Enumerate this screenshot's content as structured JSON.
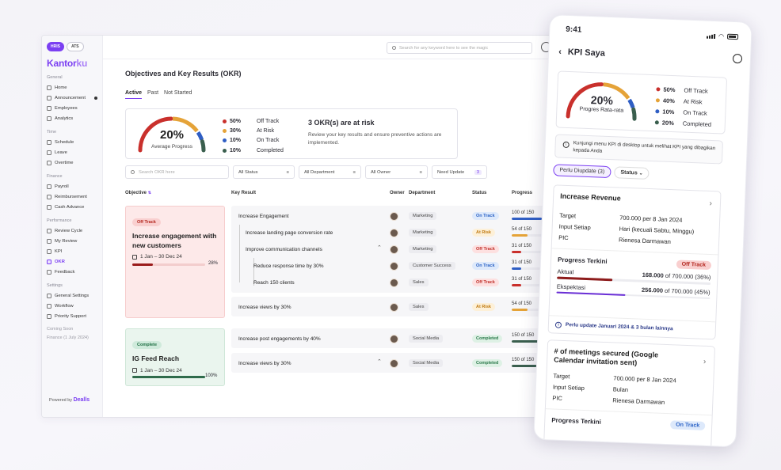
{
  "sidebar": {
    "pills": [
      "HRIS",
      "ATS"
    ],
    "logo": "Kantor",
    "logo_suffix": "ku",
    "sections": [
      {
        "title": "General",
        "items": [
          "Home",
          "Announcement",
          "Employees",
          "Analytics"
        ]
      },
      {
        "title": "Time",
        "items": [
          "Schedule",
          "Leave",
          "Overtime"
        ]
      },
      {
        "title": "Finance",
        "items": [
          "Payroll",
          "Reimbursement",
          "Cash Advance"
        ]
      },
      {
        "title": "Performance",
        "items": [
          "Review Cycle",
          "My Review",
          "KPI",
          "OKR",
          "Feedback"
        ]
      },
      {
        "title": "Settings",
        "items": [
          "General Settings",
          "Workflow",
          "Priority Support"
        ]
      }
    ],
    "coming_soon": "Coming Soon",
    "coming_soon_item": "Finance (1 July 2024)",
    "powered_by": "Powered by",
    "powered_brand": "Dealls"
  },
  "topbar": {
    "search_placeholder": "Search for any keyword here to see the magic"
  },
  "page": {
    "title": "Objectives and Key Results (OKR)",
    "tabs": [
      "Active",
      "Past",
      "Not Started"
    ]
  },
  "summary": {
    "percent": "20%",
    "caption": "Average Progress",
    "gauge": {
      "off_track": 0.5,
      "at_risk": 0.3,
      "on_track": 0.1,
      "completed": 0.1
    },
    "legend": [
      {
        "pct": "50%",
        "label": "Off Track",
        "color": "#c9302c"
      },
      {
        "pct": "30%",
        "label": "At Risk",
        "color": "#e5a338"
      },
      {
        "pct": "10%",
        "label": "On Track",
        "color": "#2f5ec4"
      },
      {
        "pct": "10%",
        "label": "Completed",
        "color": "#3a5f4e"
      }
    ],
    "risk_title": "3 OKR(s) are at risk",
    "risk_text": "Review your key results and ensure preventive actions are implemented."
  },
  "filters": {
    "search_placeholder": "Search OKR here",
    "status": "All Status",
    "department": "All Department",
    "owner": "All Owner",
    "need_update": "Need Update",
    "need_update_count": "3"
  },
  "columns": [
    "Objective",
    "Key Result",
    "Owner",
    "Department",
    "Status",
    "Progress"
  ],
  "objectives": [
    {
      "status": "Off Track",
      "title": "Increase engagement with new customers",
      "date": "1 Jan – 30 Dec 24",
      "progress": "28%",
      "progress_value": 0.28
    },
    {
      "status": "Complete",
      "title": "IG Feed Reach",
      "date": "1 Jan – 30 Dec 24",
      "progress": "100%",
      "progress_value": 1.0
    }
  ],
  "key_results": [
    {
      "name": "Increase Engagement",
      "dept": "Marketing",
      "status": "On Track",
      "progress": "100 of 150",
      "value": 0.67
    },
    {
      "name": "Increase landing page conversion rate",
      "dept": "Marketing",
      "status": "At Risk",
      "progress": "54 of 150",
      "value": 0.36
    },
    {
      "name": "Improve communication channels",
      "dept": "Marketing",
      "status": "Off Track",
      "progress": "31 of 150",
      "value": 0.21
    },
    {
      "name": "Reduce response time by 30%",
      "dept": "Customer Success",
      "status": "On Track",
      "progress": "31 of 150",
      "value": 0.21
    },
    {
      "name": "Reach 150 clients",
      "dept": "Sales",
      "status": "Off Track",
      "progress": "31 of 150",
      "value": 0.21
    },
    {
      "name": "Increase views by 30%",
      "dept": "Sales",
      "status": "At Risk",
      "progress": "54 of 150",
      "value": 0.36
    },
    {
      "name": "Increase post engagements by 40%",
      "dept": "Social Media",
      "status": "Completed",
      "progress": "150 of 150",
      "value": 1.0
    },
    {
      "name": "Increase views by 30%",
      "dept": "Social Media",
      "status": "Completed",
      "progress": "150 of 150",
      "value": 1.0
    }
  ],
  "phone": {
    "time": "9:41",
    "title": "KPI Saya",
    "percent": "20%",
    "caption": "Progres Rata-rata",
    "legend": [
      {
        "pct": "50%",
        "label": "Off Track"
      },
      {
        "pct": "40%",
        "label": "At Risk"
      },
      {
        "pct": "10%",
        "label": "On Track"
      },
      {
        "pct": "20%",
        "label": "Completed"
      }
    ],
    "note": "Kunjungi menu KPI di desktop untuk melihat KPI yang dibagikan kepada Anda",
    "chip_update": "Perlu Diupdate (3)",
    "chip_status": "Status",
    "card1": {
      "title": "Increase Revenue",
      "target_label": "Target",
      "target": "700.000 per 8 Jan 2024",
      "input_label": "Input Setiap",
      "input": "Hari (kecuali Sabtu, Minggu)",
      "pic_label": "PIC",
      "pic": "Rienesa Darmawan",
      "progress_label": "Progress Terkini",
      "status": "Off Track",
      "actual_label": "Aktual",
      "actual_val": "168.000",
      "actual_rest": "of 700.000 (36%)",
      "actual_value": 0.36,
      "expect_label": "Ekspektasi",
      "expect_val": "256.000",
      "expect_rest": "of 700.000 (45%)",
      "expect_value": 0.45,
      "footer": "Perlu update Januari 2024 & 3 bulan lainnya"
    },
    "card2": {
      "title": "# of meetings secured (Google Calendar invitation sent)",
      "target_label": "Target",
      "target": "700.000 per 8 Jan 2024",
      "input_label": "Input Setiap",
      "input": "Bulan",
      "pic_label": "PIC",
      "pic": "Rienesa Darmawan",
      "progress_label": "Progress Terkini",
      "status": "On Track"
    }
  }
}
